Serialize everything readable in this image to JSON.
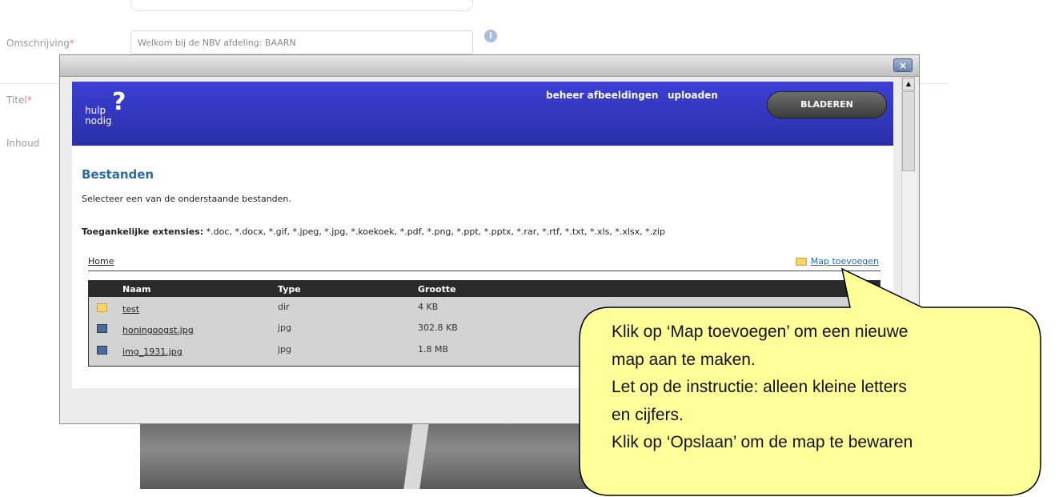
{
  "background": {
    "omschrijving_label": "Omschrijving",
    "required_mark": "*",
    "omschrijving_value": "Welkom bij de NBV afdeling: BAARN",
    "titel_label": "Titel",
    "inhoud_label": "Inhoud",
    "info_icon": "info-icon"
  },
  "dialog": {
    "close_label": "×",
    "scroll_up": "▲",
    "header": {
      "logo_line1": "hulp",
      "logo_q": "?",
      "logo_line2": "nodig",
      "nav_beheer": "beheer afbeeldingen",
      "nav_uploaden": "uploaden",
      "bladeren": "BLADEREN"
    },
    "title": "Bestanden",
    "instruction": "Selecteer een van de onderstaande bestanden.",
    "extensions_label": "Toegankelijke extensies:",
    "extensions_value": " *.doc, *.docx, *.gif, *.jpeg, *.jpg, *.koekoek, *.pdf, *.png, *.ppt, *.pptx, *.rar, *.rtf, *.txt, *.xls, *.xlsx, *.zip",
    "breadcrumb_home": "Home",
    "map_toevoegen": "Map toevoegen",
    "table": {
      "headers": [
        "Naam",
        "Type",
        "Grootte"
      ],
      "rows": [
        {
          "name": "test",
          "type": "dir",
          "size": "4 KB",
          "icon": "folder-icon"
        },
        {
          "name": "honingoogst.jpg",
          "type": "jpg",
          "size": "302.8 KB",
          "icon": "image-file-icon"
        },
        {
          "name": "img_1931.jpg",
          "type": "jpg",
          "size": "1.8 MB",
          "icon": "image-file-icon"
        }
      ]
    }
  },
  "callout": {
    "lines": [
      "Klik op ‘Map toevoegen’ om een nieuwe",
      "map aan te maken.",
      "Let op de instructie: alleen kleine letters",
      "en cijfers.",
      "Klik op ‘Opslaan’ om de map te bewaren"
    ],
    "fill": "#ffff99",
    "stroke": "#000000"
  }
}
